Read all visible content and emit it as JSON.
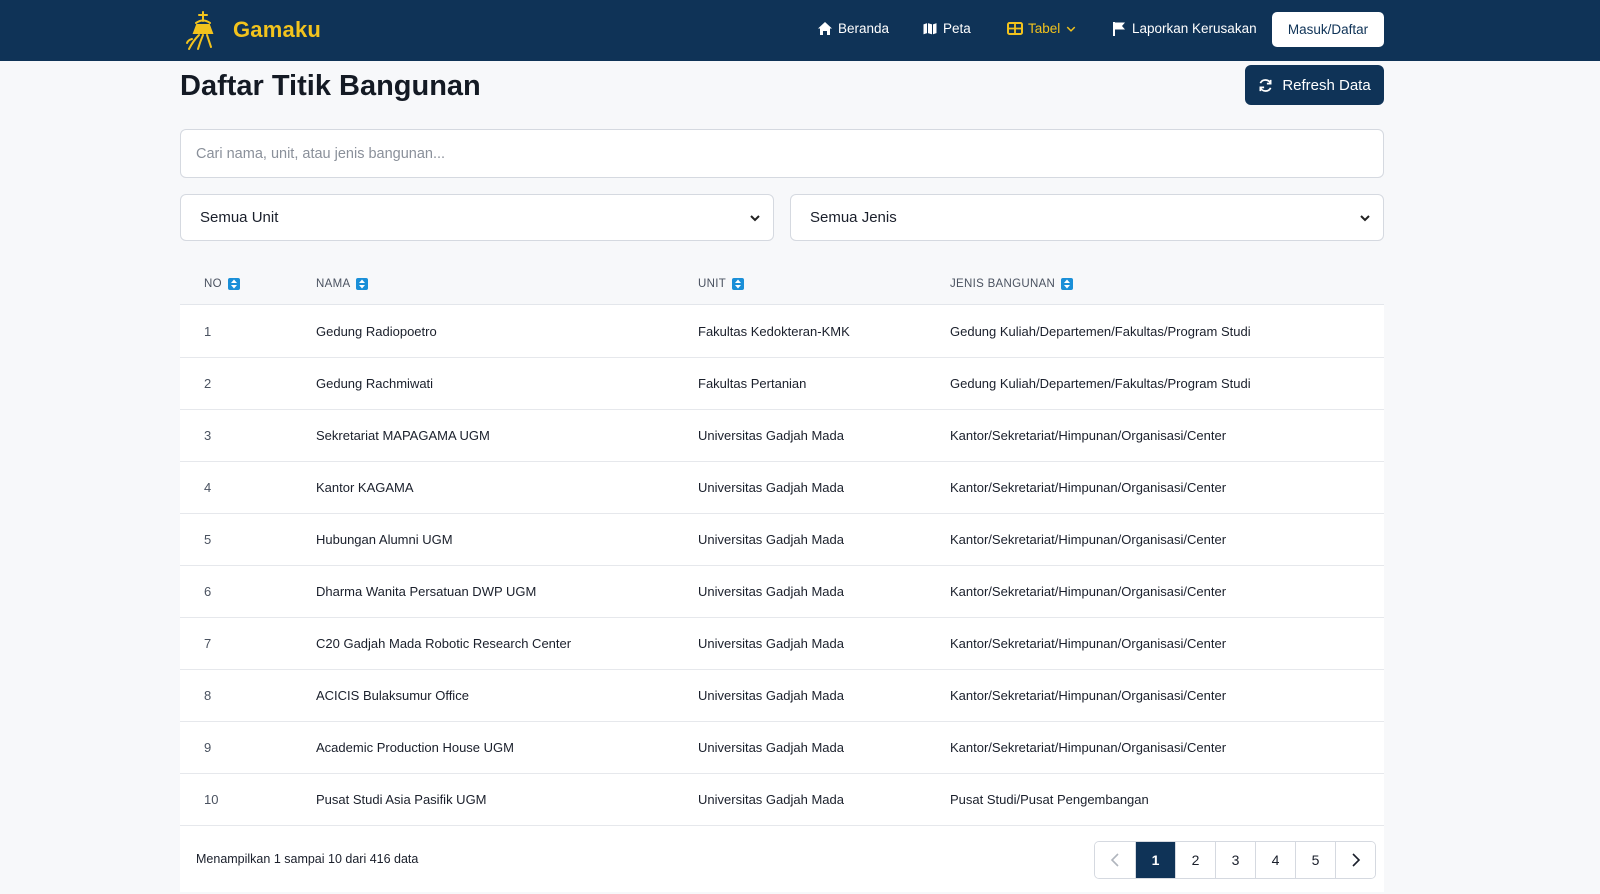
{
  "brand": {
    "name": "Gamaku",
    "logo_icon": "ugm-logo-icon"
  },
  "nav": {
    "items": [
      {
        "label": "Beranda",
        "icon": "home-icon"
      },
      {
        "label": "Peta",
        "icon": "map-icon"
      },
      {
        "label": "Tabel",
        "icon": "table-icon",
        "active": true
      },
      {
        "label": "Laporkan Kerusakan",
        "icon": "flag-icon"
      }
    ],
    "login_label": "Masuk/Daftar"
  },
  "page": {
    "title": "Daftar Titik Bangunan",
    "refresh_label": "Refresh Data"
  },
  "search": {
    "placeholder": "Cari nama, unit, atau jenis bangunan..."
  },
  "filters": {
    "unit_selected": "Semua Unit",
    "jenis_selected": "Semua Jenis"
  },
  "table": {
    "headers": {
      "no": "NO",
      "nama": "NAMA",
      "unit": "UNIT",
      "jenis": "JENIS BANGUNAN"
    },
    "rows": [
      {
        "no": "1",
        "nama": "Gedung Radiopoetro",
        "unit": "Fakultas Kedokteran-KMK",
        "jenis": "Gedung Kuliah/Departemen/Fakultas/Program Studi"
      },
      {
        "no": "2",
        "nama": "Gedung Rachmiwati",
        "unit": "Fakultas Pertanian",
        "jenis": "Gedung Kuliah/Departemen/Fakultas/Program Studi"
      },
      {
        "no": "3",
        "nama": "Sekretariat MAPAGAMA UGM",
        "unit": "Universitas Gadjah Mada",
        "jenis": "Kantor/Sekretariat/Himpunan/Organisasi/Center"
      },
      {
        "no": "4",
        "nama": "Kantor KAGAMA",
        "unit": "Universitas Gadjah Mada",
        "jenis": "Kantor/Sekretariat/Himpunan/Organisasi/Center"
      },
      {
        "no": "5",
        "nama": "Hubungan Alumni UGM",
        "unit": "Universitas Gadjah Mada",
        "jenis": "Kantor/Sekretariat/Himpunan/Organisasi/Center"
      },
      {
        "no": "6",
        "nama": "Dharma Wanita Persatuan DWP UGM",
        "unit": "Universitas Gadjah Mada",
        "jenis": "Kantor/Sekretariat/Himpunan/Organisasi/Center"
      },
      {
        "no": "7",
        "nama": "C20 Gadjah Mada Robotic Research Center",
        "unit": "Universitas Gadjah Mada",
        "jenis": "Kantor/Sekretariat/Himpunan/Organisasi/Center"
      },
      {
        "no": "8",
        "nama": "ACICIS Bulaksumur Office",
        "unit": "Universitas Gadjah Mada",
        "jenis": "Kantor/Sekretariat/Himpunan/Organisasi/Center"
      },
      {
        "no": "9",
        "nama": "Academic Production House UGM",
        "unit": "Universitas Gadjah Mada",
        "jenis": "Kantor/Sekretariat/Himpunan/Organisasi/Center"
      },
      {
        "no": "10",
        "nama": "Pusat Studi Asia Pasifik UGM",
        "unit": "Universitas Gadjah Mada",
        "jenis": "Pusat Studi/Pusat Pengembangan"
      }
    ],
    "summary": "Menampilkan 1 sampai 10 dari 416 data"
  },
  "pagination": {
    "pages": [
      "1",
      "2",
      "3",
      "4",
      "5"
    ],
    "current": "1"
  },
  "colors": {
    "navbar": "#0f3357",
    "brand": "#f2c31d",
    "sort_icon": "#1a8fd8"
  }
}
